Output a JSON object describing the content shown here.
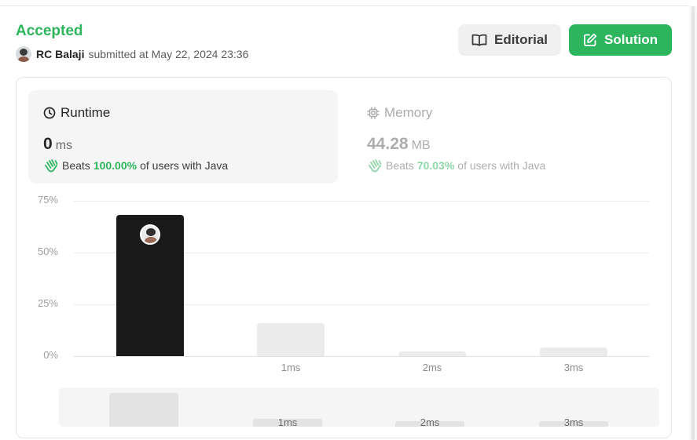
{
  "submission": {
    "status": "Accepted",
    "user_name": "RC Balaji",
    "submitted_text": "submitted at May 22, 2024 23:36"
  },
  "actions": {
    "editorial_label": "Editorial",
    "solution_label": "Solution"
  },
  "runtime": {
    "label": "Runtime",
    "value": "0",
    "unit": "ms",
    "beats_prefix": "Beats",
    "beats_percent": "100.00%",
    "beats_suffix": "of users with Java"
  },
  "memory": {
    "label": "Memory",
    "value": "44.28",
    "unit": "MB",
    "beats_prefix": "Beats",
    "beats_percent": "70.03%",
    "beats_suffix": "of users with Java"
  },
  "colors": {
    "accent_green": "#2db55d",
    "current_bar": "#1a1a1a",
    "other_bar": "#ebebeb"
  },
  "chart_data": {
    "type": "bar",
    "categories": [
      "",
      "1ms",
      "2ms",
      "3ms"
    ],
    "values": [
      68,
      16,
      2,
      4
    ],
    "current_index": 0,
    "yticks": [
      "75%",
      "50%",
      "25%",
      "0%"
    ],
    "ytick_values": [
      75,
      50,
      25,
      0
    ],
    "ylim": [
      0,
      75
    ],
    "grid": true
  },
  "overview": {
    "labels": [
      "1ms",
      "2ms",
      "3ms"
    ],
    "values": [
      68,
      16,
      2,
      4
    ]
  }
}
